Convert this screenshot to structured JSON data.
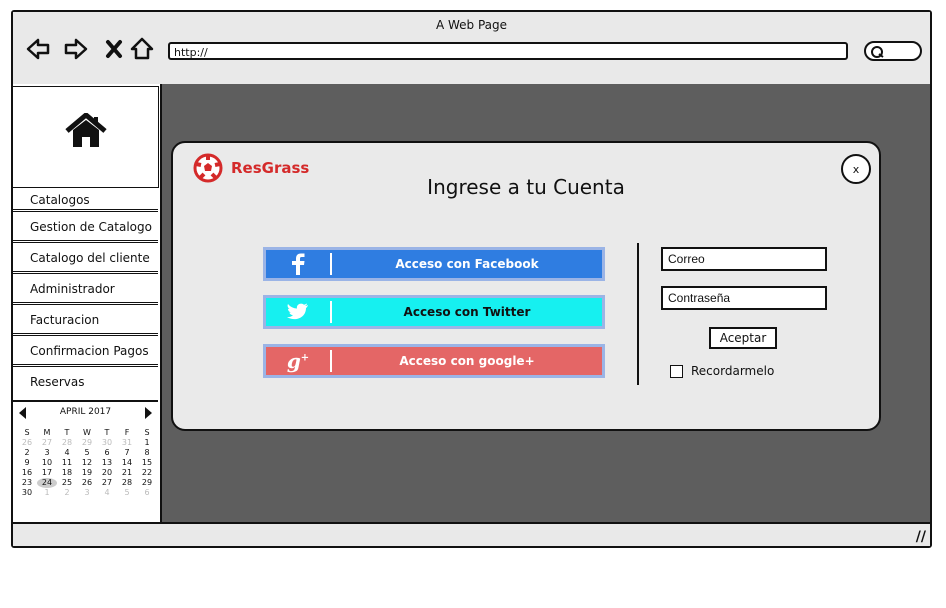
{
  "window": {
    "title": "A Web Page"
  },
  "toolbar": {
    "url": "http://"
  },
  "sidebar": {
    "menu": [
      {
        "label": "Catalogos"
      },
      {
        "label": "Gestion de Catalogo"
      },
      {
        "label": "Catalogo del cliente"
      },
      {
        "label": "Administrador"
      },
      {
        "label": "Facturacion"
      },
      {
        "label": "Confirmacion Pagos"
      },
      {
        "label": "Reservas"
      }
    ]
  },
  "calendar": {
    "month_label": "APRIL 2017",
    "weekdays": [
      "S",
      "M",
      "T",
      "W",
      "T",
      "F",
      "S"
    ],
    "weeks": [
      [
        "26",
        "27",
        "28",
        "29",
        "30",
        "31",
        "1"
      ],
      [
        "2",
        "3",
        "4",
        "5",
        "6",
        "7",
        "8"
      ],
      [
        "9",
        "10",
        "11",
        "12",
        "13",
        "14",
        "15"
      ],
      [
        "16",
        "17",
        "18",
        "19",
        "20",
        "21",
        "22"
      ],
      [
        "23",
        "24",
        "25",
        "26",
        "27",
        "28",
        "29"
      ],
      [
        "30",
        "1",
        "2",
        "3",
        "4",
        "5",
        "6"
      ]
    ],
    "selected_day": "24"
  },
  "modal": {
    "brand": "ResGrass",
    "title": "Ingrese a tu Cuenta",
    "close_label": "x",
    "facebook_label": "Acceso con Facebook",
    "twitter_label": "Acceso con Twitter",
    "google_label": "Acceso con google+",
    "email_placeholder": "Correo",
    "password_placeholder": "Contraseña",
    "accept_label": "Aceptar",
    "remember_label": "Recordarmelo"
  },
  "colors": {
    "facebook": "#2f7de1",
    "twitter": "#16f0f0",
    "google": "#e46666",
    "brand": "#d42a2a"
  }
}
